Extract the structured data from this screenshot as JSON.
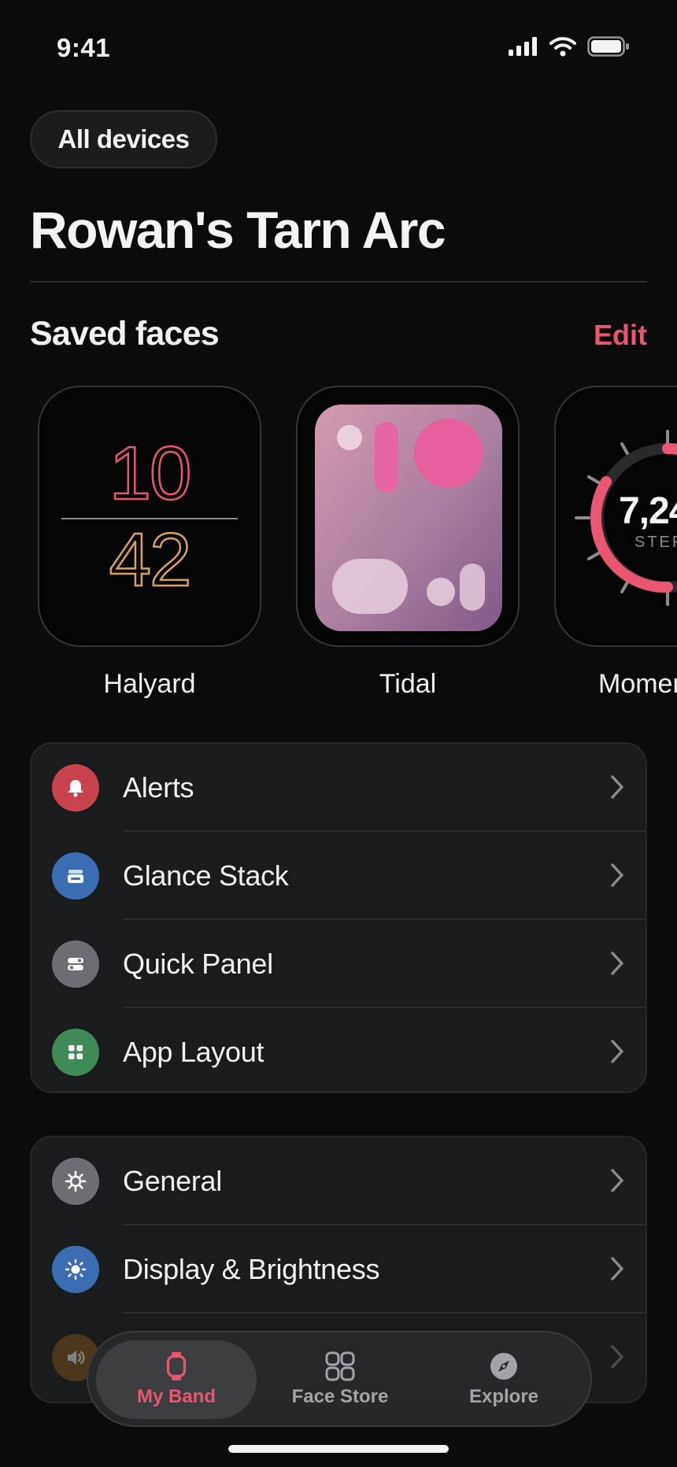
{
  "status_bar": {
    "time": "9:41"
  },
  "header": {
    "devices_button": "All devices",
    "device_name": "Rowan's Tarn Arc"
  },
  "saved_faces": {
    "title": "Saved faces",
    "edit_label": "Edit",
    "faces": [
      {
        "name": "Halyard",
        "hour": "10",
        "minute": "42"
      },
      {
        "name": "Tidal"
      },
      {
        "name": "Momer",
        "steps_value": "7,24",
        "steps_label": "STEF"
      }
    ]
  },
  "groups": [
    {
      "items": [
        {
          "label": "Alerts",
          "icon": "bell-icon",
          "color": "#c9434f"
        },
        {
          "label": "Glance Stack",
          "icon": "stack-icon",
          "color": "#3b6db3"
        },
        {
          "label": "Quick Panel",
          "icon": "toggles-icon",
          "color": "#6d6e74"
        },
        {
          "label": "App Layout",
          "icon": "grid-icon",
          "color": "#3f8a57"
        }
      ]
    },
    {
      "items": [
        {
          "label": "General",
          "icon": "gear-icon",
          "color": "#6d6e74"
        },
        {
          "label": "Display & Brightness",
          "icon": "sun-icon",
          "color": "#3b6db3"
        },
        {
          "label": "",
          "icon": "speaker-icon",
          "color": "#8a5a1e"
        }
      ]
    }
  ],
  "tab_bar": {
    "tabs": [
      {
        "label": "My Band",
        "icon": "watch-icon",
        "active": true
      },
      {
        "label": "Face Store",
        "icon": "faces-grid-icon",
        "active": false
      },
      {
        "label": "Explore",
        "icon": "compass-icon",
        "active": false
      }
    ]
  },
  "colors": {
    "accent": "#e8566f",
    "background": "#0b0b0c",
    "card": "#1a1b1d"
  }
}
